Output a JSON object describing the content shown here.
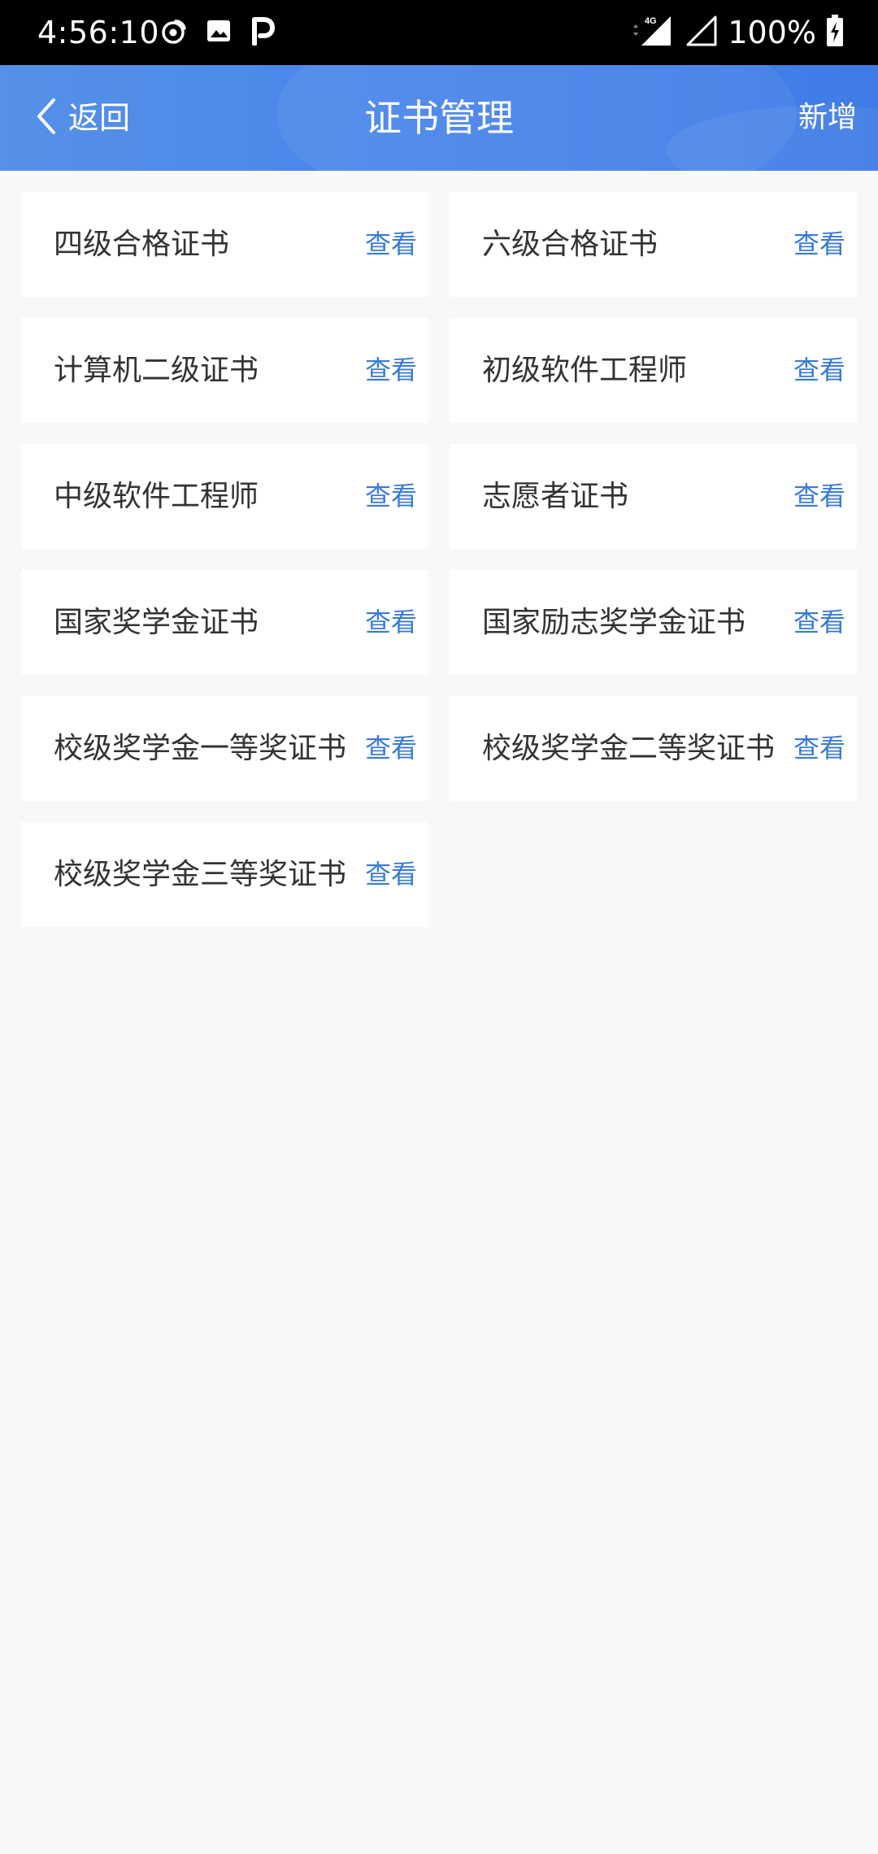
{
  "status_bar": {
    "time": "4:56:10",
    "network": "4G",
    "battery": "100%"
  },
  "header": {
    "back_label": "返回",
    "title": "证书管理",
    "add_label": "新增"
  },
  "view_label": "查看",
  "certificates": [
    {
      "name": "四级合格证书"
    },
    {
      "name": "六级合格证书"
    },
    {
      "name": "计算机二级证书"
    },
    {
      "name": "初级软件工程师"
    },
    {
      "name": "中级软件工程师"
    },
    {
      "name": "志愿者证书"
    },
    {
      "name": "国家奖学金证书"
    },
    {
      "name": "国家励志奖学金证书"
    },
    {
      "name": "校级奖学金一等奖证书"
    },
    {
      "name": "校级奖学金二等奖证书"
    },
    {
      "name": "校级奖学金三等奖证书"
    }
  ],
  "icons": {
    "status_left": [
      "weibo-icon",
      "image-icon",
      "parking-icon"
    ],
    "status_right": [
      "signal-4g-icon",
      "signal-icon",
      "battery-charging-icon"
    ],
    "back": "chevron-left-icon"
  },
  "colors": {
    "header": "#4985ea",
    "link": "#3a7bd5",
    "background": "#f8f8f8"
  }
}
